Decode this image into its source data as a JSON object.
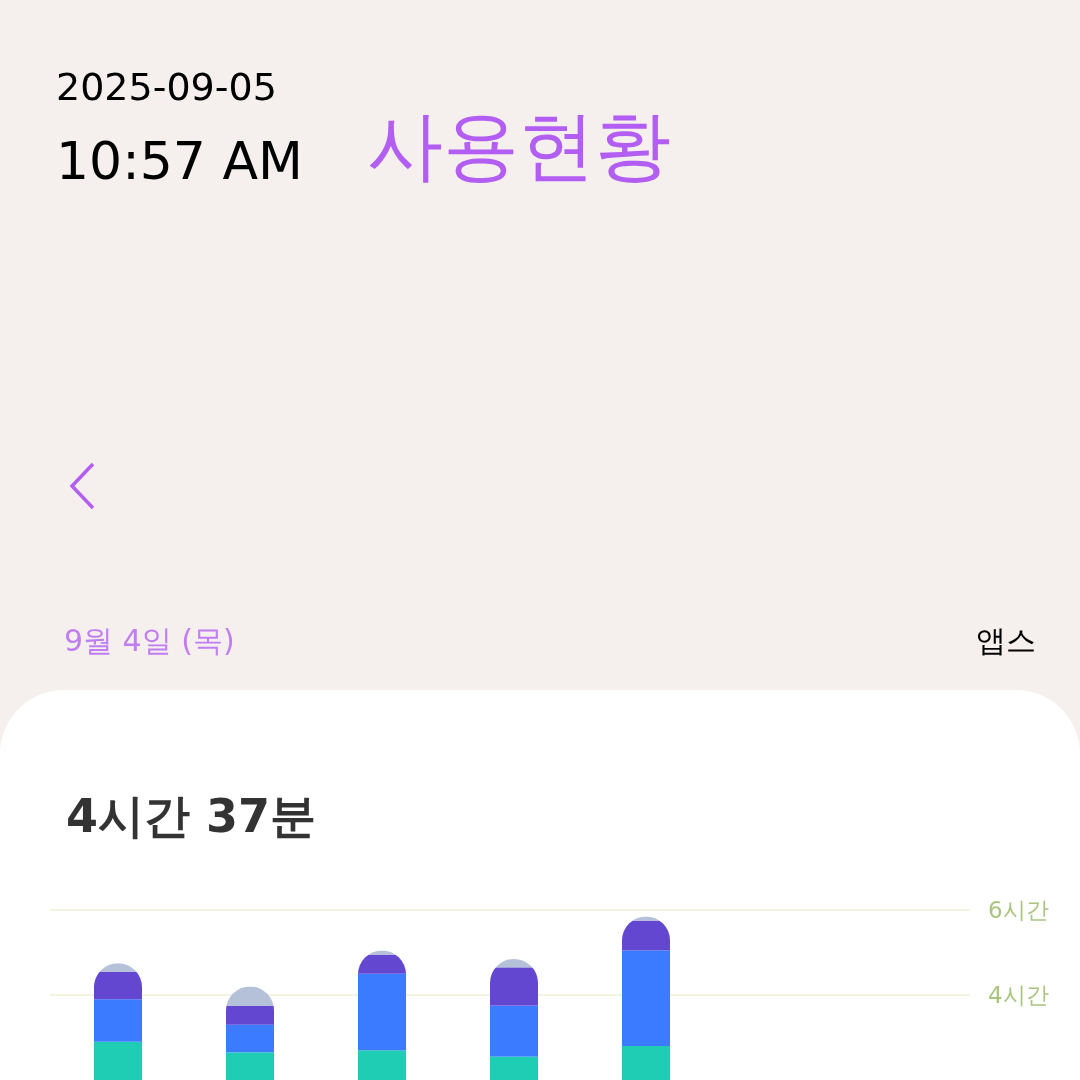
{
  "status": {
    "date": "2025-09-05",
    "time": "10:57 AM"
  },
  "title": "사용현황",
  "day": {
    "label": "9월 4일 (목)",
    "filter": "앱스"
  },
  "card": {
    "total": "4시간 37분",
    "axis_labels": [
      "6시간",
      "4시간"
    ]
  }
}
